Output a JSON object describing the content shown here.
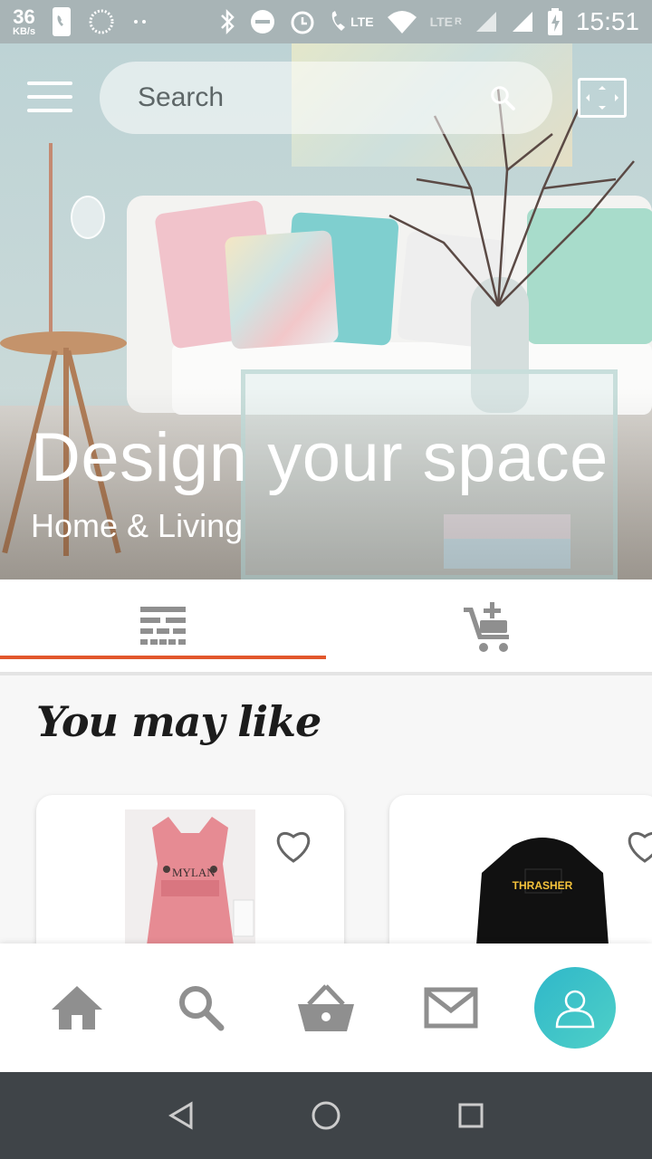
{
  "status_bar": {
    "speed_value": "36",
    "speed_unit": "KB/s",
    "lte_label_1": "LTE",
    "lte_label_2": "LTE",
    "lte_r": "R",
    "time": "15:51"
  },
  "header": {
    "search_placeholder": "Search"
  },
  "hero": {
    "title": "Design your space",
    "subtitle": "Home & Living"
  },
  "tabs": [
    {
      "icon": "grid-list-icon",
      "active": true
    },
    {
      "icon": "add-to-cart-icon",
      "active": false
    }
  ],
  "section": {
    "title": "You may like"
  },
  "products": [
    {
      "image_text": "MYLAN",
      "icon": "heart-icon"
    },
    {
      "image_text": "THRASHER",
      "icon": "heart-icon"
    }
  ],
  "bottom_nav": [
    {
      "icon": "home-icon"
    },
    {
      "icon": "search-icon"
    },
    {
      "icon": "basket-icon"
    },
    {
      "icon": "mail-icon"
    },
    {
      "icon": "profile-icon"
    }
  ],
  "colors": {
    "accent": "#e2572c",
    "profile_button": "#3cc4c9",
    "nav_icon": "#8f8f8f"
  }
}
